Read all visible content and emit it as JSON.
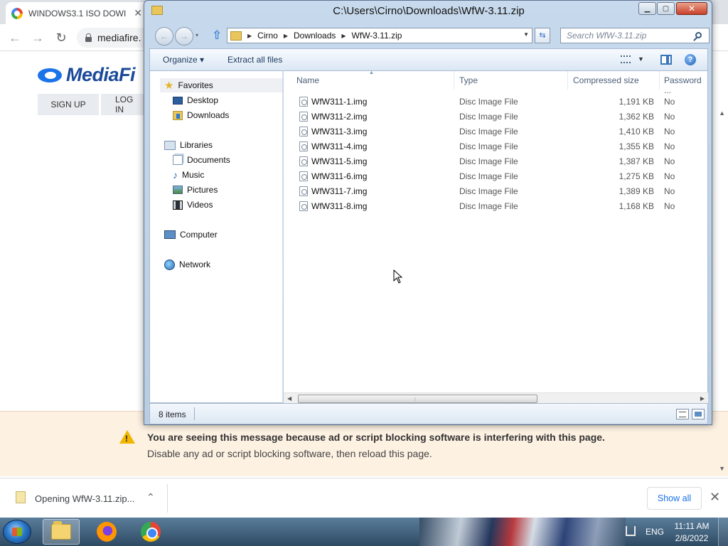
{
  "browser": {
    "tab_title": "WINDOWS3.1 ISO DOWI",
    "tab_close": "✕",
    "url": "mediafire."
  },
  "mediafire": {
    "logo_text": "MediaFi",
    "sign_up": "SIGN UP",
    "log_in": "LOG IN"
  },
  "ad_banner": {
    "line1": "You are seeing this message because ad or script blocking software is interfering with this page.",
    "line2": "Disable any ad or script blocking software, then reload this page."
  },
  "download_bar": {
    "item_label": "Opening WfW-3.11.zip...",
    "show_all": "Show all"
  },
  "explorer": {
    "title": "C:\\Users\\Cirno\\Downloads\\WfW-3.11.zip",
    "breadcrumbs": [
      "Cirno",
      "Downloads",
      "WfW-3.11.zip"
    ],
    "search_placeholder": "Search WfW-3.11.zip",
    "toolbar": {
      "organize": "Organize ▾",
      "extract": "Extract all files"
    },
    "nav": {
      "favorites": "Favorites",
      "desktop": "Desktop",
      "downloads": "Downloads",
      "libraries": "Libraries",
      "documents": "Documents",
      "music": "Music",
      "pictures": "Pictures",
      "videos": "Videos",
      "computer": "Computer",
      "network": "Network"
    },
    "columns": {
      "name": "Name",
      "type": "Type",
      "size": "Compressed size",
      "password": "Password ..."
    },
    "files": [
      {
        "name": "WfW311-1.img",
        "type": "Disc Image File",
        "size": "1,191 KB",
        "password": "No"
      },
      {
        "name": "WfW311-2.img",
        "type": "Disc Image File",
        "size": "1,362 KB",
        "password": "No"
      },
      {
        "name": "WfW311-3.img",
        "type": "Disc Image File",
        "size": "1,410 KB",
        "password": "No"
      },
      {
        "name": "WfW311-4.img",
        "type": "Disc Image File",
        "size": "1,355 KB",
        "password": "No"
      },
      {
        "name": "WfW311-5.img",
        "type": "Disc Image File",
        "size": "1,387 KB",
        "password": "No"
      },
      {
        "name": "WfW311-6.img",
        "type": "Disc Image File",
        "size": "1,275 KB",
        "password": "No"
      },
      {
        "name": "WfW311-7.img",
        "type": "Disc Image File",
        "size": "1,389 KB",
        "password": "No"
      },
      {
        "name": "WfW311-8.img",
        "type": "Disc Image File",
        "size": "1,168 KB",
        "password": "No"
      }
    ],
    "status": "8 items"
  },
  "taskbar": {
    "language": "ENG",
    "time": "11:11 AM",
    "date": "2/8/2022"
  },
  "icons": [
    "g-favicon-icon",
    "lock-icon",
    "mediafire-flame-icon",
    "warning-icon",
    "zip-file-icon",
    "folder-icon",
    "up-arrow-icon",
    "refresh-icon",
    "search-icon",
    "views-icon",
    "preview-pane-icon",
    "help-icon",
    "star-icon",
    "desktop-icon",
    "downloads-folder-icon",
    "libraries-icon",
    "documents-icon",
    "music-icon",
    "pictures-icon",
    "videos-icon",
    "computer-icon",
    "network-icon",
    "disc-image-icon",
    "start-orb-icon",
    "explorer-icon",
    "firefox-icon",
    "chrome-icon",
    "network-tray-icon"
  ]
}
